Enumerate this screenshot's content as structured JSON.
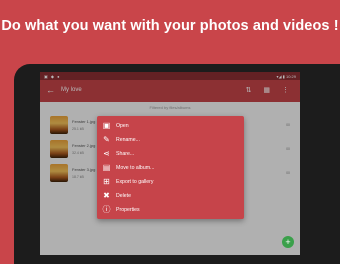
{
  "headline": "Do what you want with your photos and videos !",
  "statusbar": {
    "left_icons": "▣ ◆ ●",
    "right": "▾◢ ▮ 10:29"
  },
  "toolbar": {
    "back_icon": "←",
    "title": "My love",
    "action_icons": "⇅ ▦ ⋮"
  },
  "content": {
    "subheader": "Filtered by files/albums",
    "items": [
      {
        "title": "Fenster 1.jpg",
        "sub": "25.1 kB",
        "dur": "00"
      },
      {
        "title": "Fenster 2.jpg",
        "sub": "32.4 kB",
        "dur": "00"
      },
      {
        "title": "Fenster 3.jpg",
        "sub": "18.7 kB",
        "dur": "00"
      }
    ]
  },
  "menu": {
    "items": [
      {
        "icon": "image-icon",
        "glyph": "▣",
        "label": "Open"
      },
      {
        "icon": "pencil-icon",
        "glyph": "✎",
        "label": "Rename..."
      },
      {
        "icon": "share-icon",
        "glyph": "⋖",
        "label": "Share..."
      },
      {
        "icon": "folder-move-icon",
        "glyph": "▤",
        "label": "Move to album..."
      },
      {
        "icon": "gallery-export-icon",
        "glyph": "⊞",
        "label": "Export to gallery"
      },
      {
        "icon": "delete-icon",
        "glyph": "✖",
        "label": "Delete"
      },
      {
        "icon": "info-icon",
        "glyph": "ⓘ",
        "label": "Properties"
      }
    ]
  },
  "fab": {
    "glyph": "+"
  },
  "colors": {
    "background": "#c9454a",
    "toolbar": "#c24347",
    "statusbar": "#8a2e33",
    "menu": "#c6444a",
    "fab": "#3aa04a"
  }
}
